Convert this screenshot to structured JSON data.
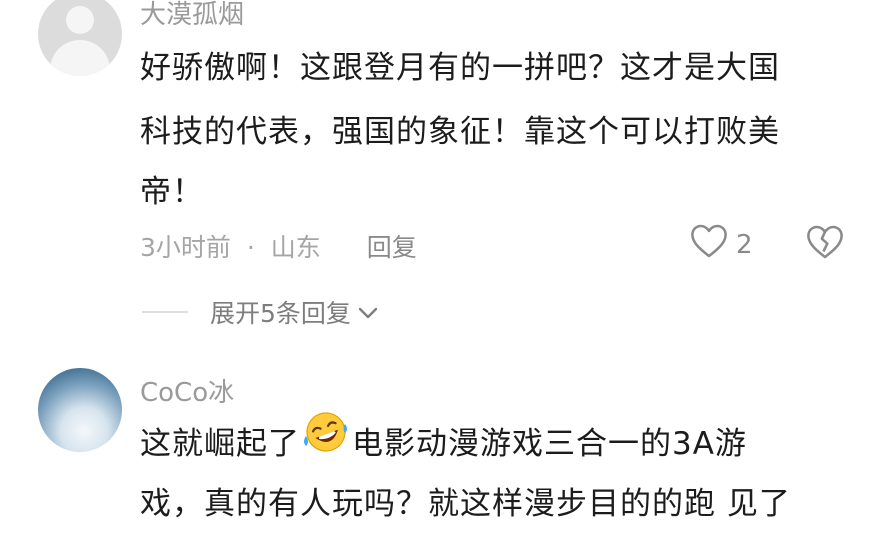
{
  "comment1": {
    "username": "大漠孤烟",
    "lines": [
      "好骄傲啊！这跟登月有的一拼吧？这才是大国",
      "科技的代表，强国的象征！靠这个可以打败美",
      "帝！"
    ],
    "time": "3小时前",
    "separator": "·",
    "location": "山东",
    "reply_label": "回复",
    "like_count": "2",
    "expand_label": "展开5条回复"
  },
  "comment2": {
    "username": "CoCo冰",
    "line1_before_emoji": "这就崛起了",
    "emoji": "rolling-on-floor-laughing",
    "line1_after_emoji": "电影动漫游戏三合一的3A游",
    "line2_partial": "戏，真的有人玩吗？就这样漫步目的的跑 见了"
  },
  "icons": {
    "heart": "heart-outline-icon",
    "broken_heart": "broken-heart-icon",
    "chevron": "chevron-down-icon"
  }
}
